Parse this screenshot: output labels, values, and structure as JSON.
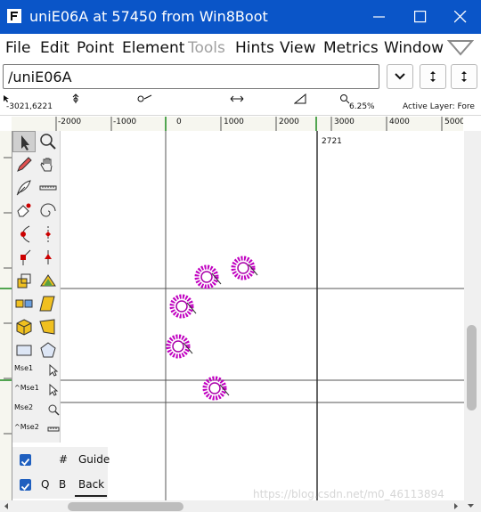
{
  "window": {
    "title": "uniE06A at 57450 from Win8Boot",
    "titlebar_color": "#0a55c8"
  },
  "menu": {
    "items": [
      {
        "label": "File"
      },
      {
        "label": "Edit"
      },
      {
        "label": "Point"
      },
      {
        "label": "Element"
      },
      {
        "label": "Tools",
        "disabled": true
      },
      {
        "label": "Hints"
      },
      {
        "label": "View"
      },
      {
        "label": "Metrics"
      },
      {
        "label": "Window"
      }
    ],
    "overflow_icon": "chevron-down-triangle-icon"
  },
  "glyph_name": {
    "value": "/uniE06A"
  },
  "info": {
    "coords": "-3021,6221",
    "zoom": "6.25%",
    "active_layer": "Active Layer: Fore"
  },
  "ruler": {
    "labels": [
      "-2000",
      "-1000",
      "0",
      "1000",
      "2000",
      "3000",
      "4000",
      "5000"
    ]
  },
  "canvas": {
    "advance_label": "2721",
    "point_color": "#c000c0"
  },
  "toolpalette": {
    "mse1": "Mse1",
    "cmse1": "^Mse1",
    "mse2": "Mse2",
    "cmse2": "^Mse2"
  },
  "layers": {
    "guide": {
      "hash": "#",
      "label": "Guide",
      "checked": true
    },
    "back": {
      "q": "Q",
      "b": "B",
      "label": "Back",
      "checked": true
    }
  },
  "watermark": "https://blog.csdn.net/m0_46113894"
}
